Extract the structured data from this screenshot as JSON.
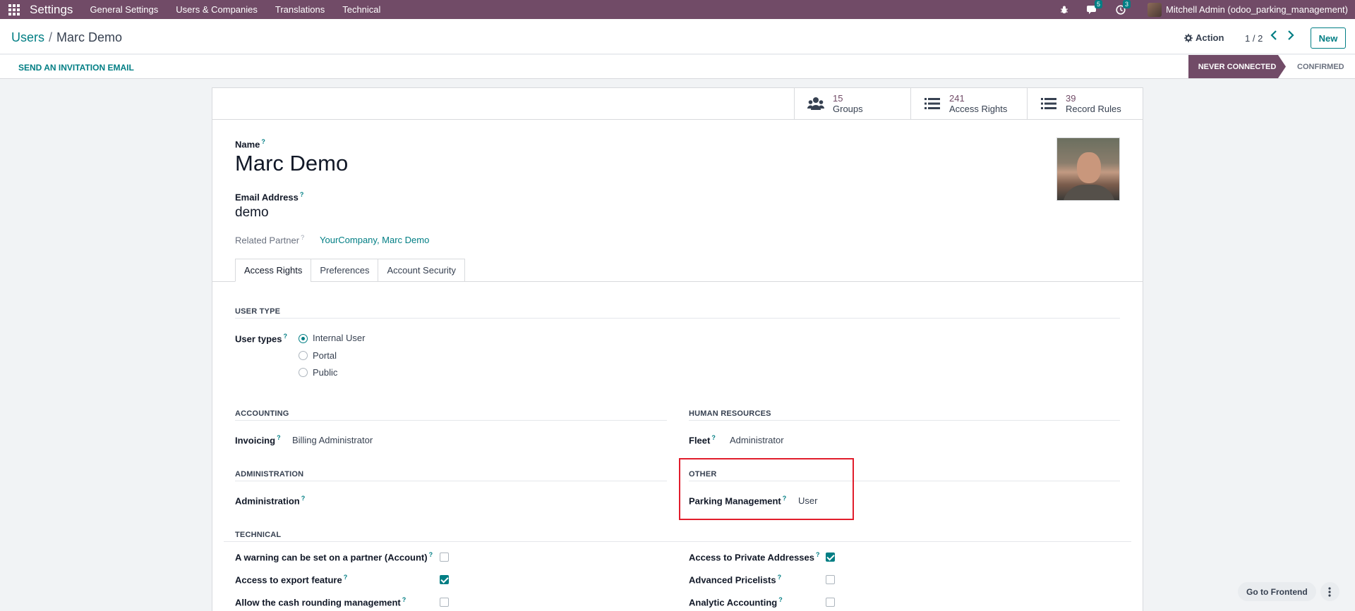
{
  "navbar": {
    "brand": "Settings",
    "menu": [
      "General Settings",
      "Users & Companies",
      "Translations",
      "Technical"
    ],
    "messages_count": "5",
    "activities_count": "3",
    "user": "Mitchell Admin (odoo_parking_management)"
  },
  "control": {
    "breadcrumb_parent": "Users",
    "breadcrumb_sep": "/",
    "breadcrumb_current": "Marc Demo",
    "action_label": "Action",
    "pager": "1 / 2",
    "new_label": "New"
  },
  "statusbar": {
    "invite_label": "SEND AN INVITATION EMAIL",
    "stage_active": "NEVER CONNECTED",
    "stage_next": "CONFIRMED"
  },
  "smart_buttons": [
    {
      "value": "15",
      "label": "Groups",
      "icon": "users-icon"
    },
    {
      "value": "241",
      "label": "Access Rights",
      "icon": "list-icon"
    },
    {
      "value": "39",
      "label": "Record Rules",
      "icon": "list-icon"
    }
  ],
  "form": {
    "name_label": "Name",
    "name_value": "Marc Demo",
    "email_label": "Email Address",
    "email_value": "demo",
    "partner_label": "Related Partner",
    "partner_value": "YourCompany, Marc Demo",
    "help": "?"
  },
  "tabs": [
    "Access Rights",
    "Preferences",
    "Account Security"
  ],
  "user_type": {
    "section": "USER TYPE",
    "label": "User types",
    "options": [
      "Internal User",
      "Portal",
      "Public"
    ],
    "selected": "Internal User"
  },
  "accounting": {
    "section": "ACCOUNTING",
    "label": "Invoicing",
    "value": "Billing Administrator"
  },
  "human_resources": {
    "section": "HUMAN RESOURCES",
    "label": "Fleet",
    "value": "Administrator"
  },
  "administration": {
    "section": "ADMINISTRATION",
    "label": "Administration",
    "value": ""
  },
  "other": {
    "section": "OTHER",
    "label": "Parking Management",
    "value": "User"
  },
  "technical": {
    "section": "TECHNICAL",
    "left": [
      {
        "label": "A warning can be set on a partner (Account)",
        "checked": false
      },
      {
        "label": "Access to export feature",
        "checked": true
      },
      {
        "label": "Allow the cash rounding management",
        "checked": false
      }
    ],
    "right": [
      {
        "label": "Access to Private Addresses",
        "checked": true
      },
      {
        "label": "Advanced Pricelists",
        "checked": false
      },
      {
        "label": "Analytic Accounting",
        "checked": false
      }
    ]
  },
  "frontend": {
    "label": "Go to Frontend"
  },
  "colors": {
    "brand": "#714b67",
    "accent": "#017e84",
    "highlight": "#e11d2c"
  }
}
